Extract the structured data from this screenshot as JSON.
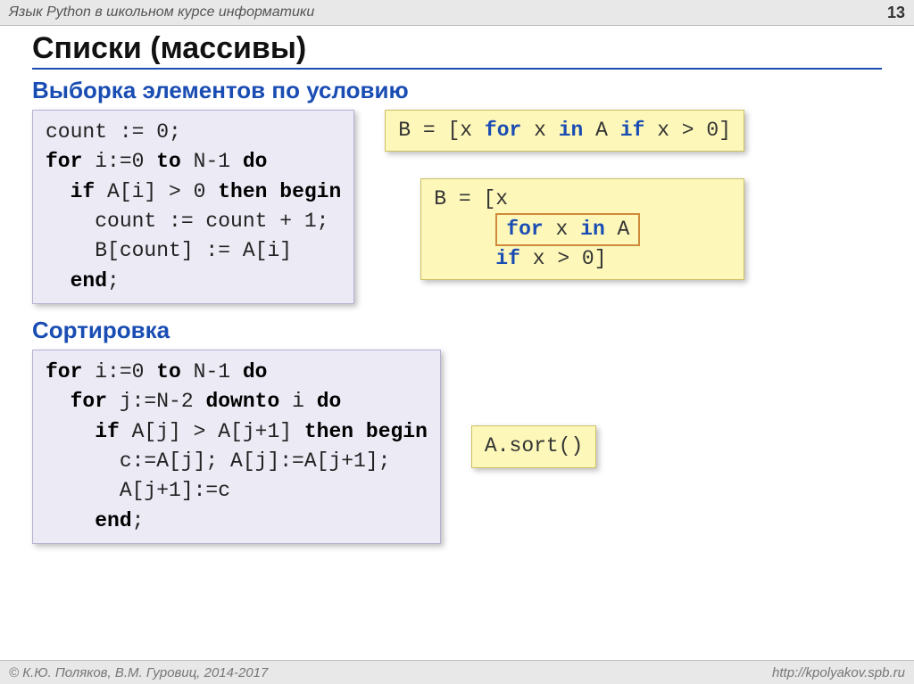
{
  "header": {
    "course_title": "Язык Python в школьном курсе информатики",
    "page_number": "13"
  },
  "slide": {
    "title": "Списки (массивы)",
    "section1_title": "Выборка элементов по условию",
    "section2_title": "Сортировка"
  },
  "code": {
    "pascal_filter": {
      "l1a": "count := 0;",
      "l2a": "for",
      "l2b": " i:=0 ",
      "l2c": "to",
      "l2d": " N-1 ",
      "l2e": "do",
      "l3a": "  if",
      "l3b": " A[i] > 0 ",
      "l3c": "then begin",
      "l4": "    count := count + 1;",
      "l5": "    B[count] := A[i]",
      "l6a": "  end",
      "l6b": ";"
    },
    "py_filter_one": {
      "a": "B = [x ",
      "b": "for",
      "c": " x ",
      "d": "in",
      "e": " A ",
      "f": "if",
      "g": " x > 0]"
    },
    "py_filter_multi": {
      "l1": "B = [x",
      "l2a": "for",
      "l2b": " x ",
      "l2c": "in",
      "l2d": " A",
      "l3a": "     if",
      "l3b": " x > 0]"
    },
    "pascal_sort": {
      "l1a": "for",
      "l1b": " i:=0 ",
      "l1c": "to",
      "l1d": " N-1 ",
      "l1e": "do",
      "l2a": "  for",
      "l2b": " j:=N-2 ",
      "l2c": "downto",
      "l2d": " i ",
      "l2e": "do",
      "l3a": "    if",
      "l3b": " A[j] > A[j+1] ",
      "l3c": "then begin",
      "l4": "      c:=A[j]; A[j]:=A[j+1];",
      "l5": "      A[j+1]:=c",
      "l6a": "    end",
      "l6b": ";"
    },
    "py_sort": "A.sort()"
  },
  "footer": {
    "copyright": "© К.Ю. Поляков, В.М. Гуровиц, 2014-2017",
    "url": "http://kpolyakov.spb.ru"
  }
}
